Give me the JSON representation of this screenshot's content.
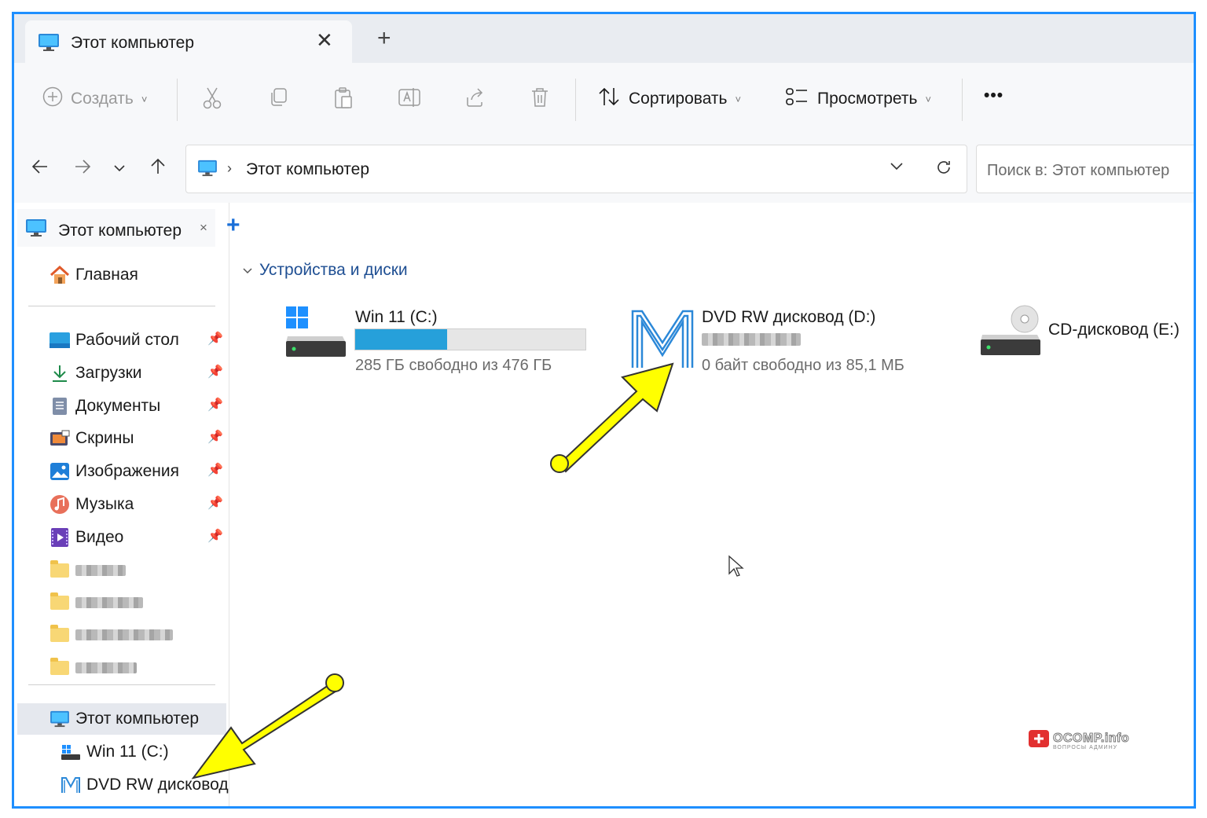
{
  "window": {
    "tab_title": "Этот компьютер",
    "new_tab": "+",
    "tab_close": "✕"
  },
  "toolbar": {
    "create_label": "Создать",
    "sort_label": "Сортировать",
    "view_label": "Просмотреть",
    "more_label": "•••"
  },
  "address": {
    "path": "Этот компьютер",
    "search_placeholder": "Поиск в: Этот компьютер"
  },
  "sidebar": {
    "tab_title": "Этот компьютер",
    "tab_close": "×",
    "add_tab": "+",
    "home": "Главная",
    "pinned": [
      {
        "label": "Рабочий стол",
        "icon": "desktop-icon"
      },
      {
        "label": "Загрузки",
        "icon": "downloads-icon"
      },
      {
        "label": "Документы",
        "icon": "documents-icon"
      },
      {
        "label": "Скрины",
        "icon": "screenshots-icon"
      },
      {
        "label": "Изображения",
        "icon": "pictures-icon"
      },
      {
        "label": "Музыка",
        "icon": "music-icon"
      },
      {
        "label": "Видео",
        "icon": "video-icon"
      }
    ],
    "this_pc": "Этот компьютер",
    "drive_c": "Win 11 (C:)",
    "drive_d": "DVD RW дисковод"
  },
  "content": {
    "group_label": "Устройства и диски",
    "drives": [
      {
        "name": "Win 11 (C:)",
        "free": "285 ГБ свободно из 476 ГБ",
        "used_fraction": 0.4
      },
      {
        "name": "DVD RW дисковод (D:)",
        "free": "0 байт свободно из 85,1 МБ"
      },
      {
        "name": "CD-дисковод (E:)"
      }
    ]
  },
  "watermark": {
    "brand": "OCOMP.info",
    "tagline": "ВОПРОСЫ АДМИНУ"
  },
  "colors": {
    "frame": "#1e8fff",
    "accent": "#26a0da",
    "annotation_arrow": "#ffff00"
  }
}
